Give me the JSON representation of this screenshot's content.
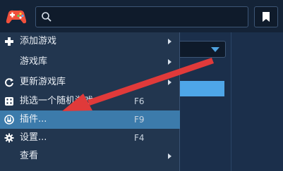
{
  "app": {
    "logo": "gamepad-icon",
    "search": {
      "placeholder": ""
    },
    "bookmark_icon": "bookmark-icon"
  },
  "menu": {
    "items": [
      {
        "label": "添加游戏",
        "icon": "plus-icon",
        "shortcut": "",
        "submenu": true
      },
      {
        "label": "游戏库",
        "icon": "",
        "shortcut": "",
        "submenu": true
      },
      {
        "label": "更新游戏库",
        "icon": "refresh-icon",
        "shortcut": "",
        "submenu": true
      },
      {
        "label": "挑选一个随机游戏",
        "icon": "dice-icon",
        "shortcut": "F6",
        "submenu": false
      },
      {
        "label": "插件...",
        "icon": "plugin-icon",
        "shortcut": "F9",
        "submenu": false,
        "highlighted": true
      },
      {
        "label": "设置...",
        "icon": "gear-icon",
        "shortcut": "F4",
        "submenu": false
      },
      {
        "label": "查看",
        "icon": "",
        "shortcut": "",
        "submenu": true
      }
    ]
  },
  "colors": {
    "background": "#1a2c45",
    "menu_bg": "#22364f",
    "highlight": "#3c7bab",
    "accent_blue": "#4ea6e8",
    "annotation_arrow": "#e03a3a"
  }
}
